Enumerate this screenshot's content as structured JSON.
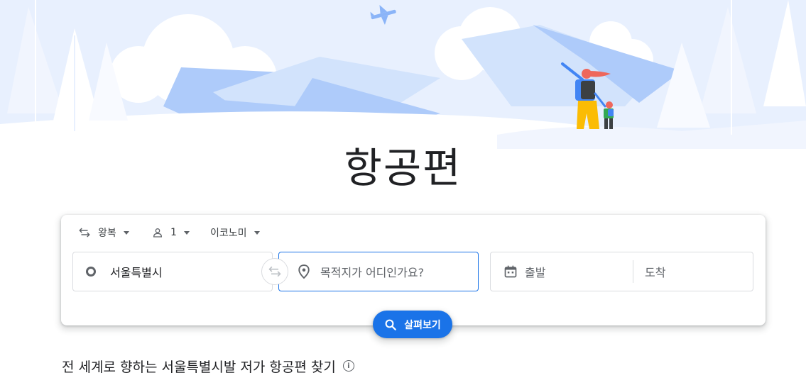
{
  "hero": {
    "illustration": "mountains-hikers-plane-illustration"
  },
  "page": {
    "title": "항공편"
  },
  "search": {
    "trip_type": "왕복",
    "passengers": "1",
    "cabin_class": "이코노미",
    "origin": "서울특별시",
    "destination_placeholder": "목적지가 어디인가요?",
    "depart_label": "출발",
    "return_label": "도착",
    "explore_label": "살펴보기"
  },
  "section": {
    "heading": "전 세계로 향하는 서울특별시발 저가 항공편 찾기",
    "info_icon": "i"
  },
  "colors": {
    "accent": "#1a73e8",
    "illustration_blue": "#aecbfa",
    "illustration_light": "#e8f0fe"
  }
}
